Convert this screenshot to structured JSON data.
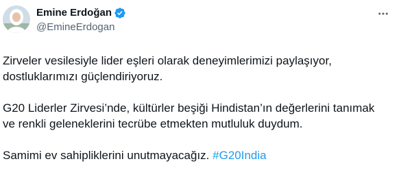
{
  "author": {
    "display_name": "Emine Erdoğan",
    "handle": "@EmineErdogan",
    "verified": true
  },
  "icons": {
    "verified": "verified-badge-icon",
    "more": "more-horizontal-icon"
  },
  "colors": {
    "link": "#1d9bf0",
    "verified_badge": "#1d9bf0",
    "secondary_text": "#536471",
    "primary_text": "#0f1419"
  },
  "tweet": {
    "paragraph_1_line_1": "Zirveler vesilesiyle lider eşleri olarak deneyimlerimizi paylaşıyor,",
    "paragraph_1_line_2": "dostluklarımızı güçlendiriyoruz.",
    "paragraph_2_line_1": "G20 Liderler Zirvesi’nde, kültürler beşiği Hindistan’ın değerlerini tanımak",
    "paragraph_2_line_2": "ve renkli geleneklerini tecrübe etmekten mutluluk duydum.",
    "paragraph_3_text": "Samimi ev sahipliklerini unutmayacağız.",
    "hashtag": "#G20India"
  }
}
